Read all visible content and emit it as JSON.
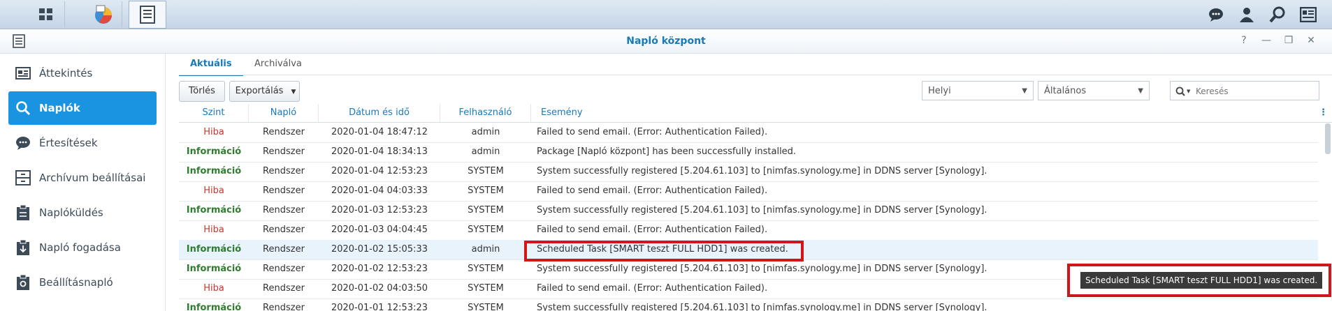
{
  "taskbar": {
    "left_icons": [
      "app-grid-icon",
      "control-panel-icon",
      "log-center-icon"
    ],
    "right_icons": [
      "chat-icon",
      "user-icon",
      "search-icon",
      "widgets-icon"
    ]
  },
  "window": {
    "title": "Napló központ",
    "controls": {
      "help": "?",
      "minimize": "—",
      "restore": "❐",
      "close": "✕"
    }
  },
  "sidebar": {
    "items": [
      {
        "label": "Áttekintés",
        "icon": "overview-icon"
      },
      {
        "label": "Naplók",
        "icon": "search-icon",
        "active": true
      },
      {
        "label": "Értesítések",
        "icon": "chat-bubble-icon"
      },
      {
        "label": "Archívum beállításai",
        "icon": "archive-icon"
      },
      {
        "label": "Naplóküldés",
        "icon": "clipboard-send-icon"
      },
      {
        "label": "Napló fogadása",
        "icon": "clipboard-receive-icon"
      },
      {
        "label": "Beállításnapló",
        "icon": "clipboard-settings-icon"
      }
    ]
  },
  "tabs": [
    {
      "label": "Aktuális",
      "active": true
    },
    {
      "label": "Archiválva",
      "active": false
    }
  ],
  "toolbar": {
    "delete_label": "Törlés",
    "export_label": "Exportálás",
    "source_select": "Helyi",
    "type_select": "Általános",
    "search_placeholder": "Keresés"
  },
  "table": {
    "columns": [
      "Szint",
      "Napló",
      "Dátum és idő",
      "Felhasználó",
      "Esemény"
    ],
    "rows": [
      {
        "level": "Hiba",
        "type": "error",
        "log": "Rendszer",
        "datetime": "2020-01-04 18:47:12",
        "user": "admin",
        "event": "Failed to send email. (Error: Authentication Failed)."
      },
      {
        "level": "Információ",
        "type": "info",
        "log": "Rendszer",
        "datetime": "2020-01-04 18:34:13",
        "user": "admin",
        "event": "Package [Napló központ] has been successfully installed."
      },
      {
        "level": "Információ",
        "type": "info",
        "log": "Rendszer",
        "datetime": "2020-01-04 12:53:23",
        "user": "SYSTEM",
        "event": "System successfully registered [5.204.61.103] to [nimfas.synology.me] in DDNS server [Synology]."
      },
      {
        "level": "Hiba",
        "type": "error",
        "log": "Rendszer",
        "datetime": "2020-01-04 04:03:33",
        "user": "SYSTEM",
        "event": "Failed to send email. (Error: Authentication Failed)."
      },
      {
        "level": "Információ",
        "type": "info",
        "log": "Rendszer",
        "datetime": "2020-01-03 12:53:23",
        "user": "SYSTEM",
        "event": "System successfully registered [5.204.61.103] to [nimfas.synology.me] in DDNS server [Synology]."
      },
      {
        "level": "Hiba",
        "type": "error",
        "log": "Rendszer",
        "datetime": "2020-01-03 04:04:45",
        "user": "SYSTEM",
        "event": "Failed to send email. (Error: Authentication Failed)."
      },
      {
        "level": "Információ",
        "type": "info",
        "log": "Rendszer",
        "datetime": "2020-01-02 15:05:33",
        "user": "admin",
        "event": "Scheduled Task [SMART teszt FULL HDD1] was created.",
        "selected": true
      },
      {
        "level": "Információ",
        "type": "info",
        "log": "Rendszer",
        "datetime": "2020-01-02 12:53:23",
        "user": "SYSTEM",
        "event": "System successfully registered [5.204.61.103] to [nimfas.synology.me] in DDNS server [Synology]."
      },
      {
        "level": "Hiba",
        "type": "error",
        "log": "Rendszer",
        "datetime": "2020-01-02 04:03:50",
        "user": "SYSTEM",
        "event": "Failed to send email. (Error: Authentication Failed)."
      },
      {
        "level": "Információ",
        "type": "info",
        "log": "Rendszer",
        "datetime": "2020-01-01 12:53:23",
        "user": "SYSTEM",
        "event": "System successfully registered [5.204.61.103] to [nimfas.synology.me] in DDNS server [Synology]."
      }
    ]
  },
  "tooltip": {
    "text": "Scheduled Task [SMART teszt FULL HDD1] was created."
  },
  "colors": {
    "accent": "#1a93e0",
    "title": "#1a7ab8",
    "error": "#c0392b",
    "info": "#2f7d2f",
    "highlight": "#d0161b"
  }
}
